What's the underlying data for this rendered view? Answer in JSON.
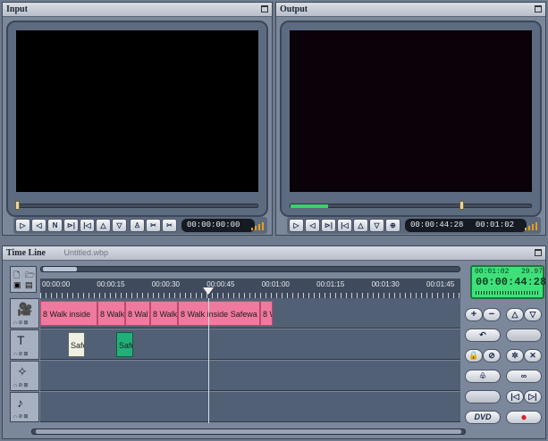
{
  "input_panel": {
    "title": "Input",
    "timecode": "00:00:00:00",
    "buttons": [
      "▷",
      "◁",
      "N",
      "⊳|",
      "|◁",
      "△",
      "▽",
      "♙",
      "✂",
      "✂"
    ]
  },
  "output_panel": {
    "title": "Output",
    "timecode": "00:00:44:28",
    "duration": "00:01:02",
    "buttons": [
      "▷",
      "◁",
      "⊳|",
      "|◁",
      "△",
      "▽",
      "⊕"
    ],
    "progress_fraction": 0.15,
    "playhead_fraction": 0.7
  },
  "timeline": {
    "title": "Time Line",
    "project_name": "Untitled.wbp",
    "ruler_labels": [
      "00:00:00",
      "00:00:15",
      "00:00:30",
      "00:00:45",
      "00:01:00",
      "00:01:15",
      "00:01:30",
      "00:01:45"
    ],
    "video_clips": [
      "8 Walk inside",
      "8 Walk",
      "8 Wal",
      "8 Walk",
      "8 Walk inside Safewa",
      "8 W"
    ],
    "title_clips": [
      "Safe",
      "Safe"
    ],
    "track_head_label": "∩⊘⊠"
  },
  "status": {
    "duration": "00:01:02",
    "fps": "29.97",
    "timecode": "00:00:44:28"
  },
  "side_buttons": {
    "plus": "+",
    "minus": "−",
    "up": "△",
    "down": "▽",
    "dvd": "DVD",
    "record": "●"
  },
  "colors": {
    "clip_pink": "#f07a9f",
    "clip_selected": "#22b07a",
    "green_display": "#3fe07a"
  }
}
